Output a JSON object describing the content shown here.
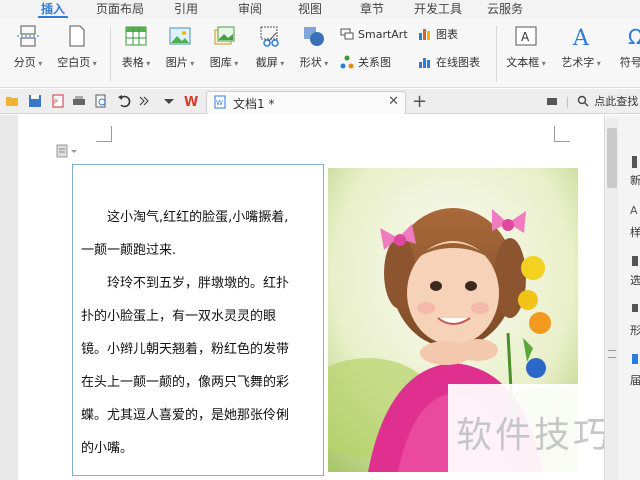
{
  "ribbon_tabs": [
    "插入",
    "页面布局",
    "引用",
    "审阅",
    "视图",
    "章节",
    "开发工具",
    "云服务"
  ],
  "active_tab": "插入",
  "ribbon": {
    "page_break": "分页",
    "blank_page": "空白页",
    "table": "表格",
    "picture": "图片",
    "gallery": "图库",
    "screenshot": "截屏",
    "shape": "形状",
    "smartart": "SmartArt",
    "chart": "图表",
    "relation": "关系图",
    "online_chart": "在线图表",
    "textbox": "文本框",
    "wordart": "艺术字",
    "symbol": "符号"
  },
  "quickbar": {
    "doc_title": "文档1 *",
    "search_hint": "点此查找"
  },
  "document": {
    "para1_line1": "这小淘气,红红的脸蛋,小嘴撅着,",
    "para1_line2": "一颠一颠跑过来.",
    "para2_lines": [
      "玲玲不到五岁，胖墩墩的。红扑",
      "扑的小脸蛋上，有一双水灵灵的眼",
      "镜。小辫儿朝天翘着，粉红色的发带",
      "在头上一颠一颠的，像两只飞舞的彩",
      "蝶。尤其逗人喜爱的，是她那张伶俐",
      "的小嘴。"
    ]
  },
  "watermark": "软件技巧",
  "sidepane_labels": [
    "新",
    "样",
    "选",
    "形",
    "届"
  ],
  "colors": {
    "accent": "#2f7bd8",
    "frame_border": "#7eb0c9",
    "wps_red": "#d93a2b"
  }
}
